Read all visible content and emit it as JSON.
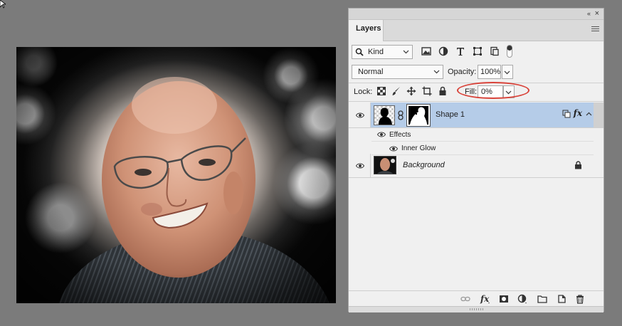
{
  "panel": {
    "tab_label": "Layers",
    "collapse_glyph": "«",
    "close_glyph": "×"
  },
  "filter": {
    "kind_label": "Kind",
    "icons": [
      "image-filter-icon",
      "adjustment-filter-icon",
      "type-filter-icon",
      "shape-filter-icon",
      "smart-object-filter-icon"
    ]
  },
  "blend": {
    "mode": "Normal",
    "opacity_label": "Opacity:",
    "opacity_value": "100%"
  },
  "lock": {
    "label": "Lock:",
    "icons": [
      "lock-transparent-pixels-icon",
      "lock-image-pixels-icon",
      "lock-position-icon",
      "lock-artboard-icon",
      "lock-all-icon"
    ],
    "fill_label": "Fill:",
    "fill_value": "0%"
  },
  "layers": [
    {
      "name": "Shape 1",
      "selected": true,
      "effects_label": "Effects",
      "effects": [
        "Inner Glow"
      ]
    },
    {
      "name": "Background",
      "locked": true
    }
  ],
  "bottom_icons": [
    "link-layers-icon",
    "add-style-icon",
    "add-mask-icon",
    "new-adjustment-icon",
    "new-group-icon",
    "new-layer-icon",
    "delete-layer-icon"
  ],
  "colors": {
    "selected_row": "#b5cce8",
    "highlight_ring": "#d9433a",
    "panel_bg": "#f0f0f0",
    "workspace_bg": "#7b7b7b"
  }
}
